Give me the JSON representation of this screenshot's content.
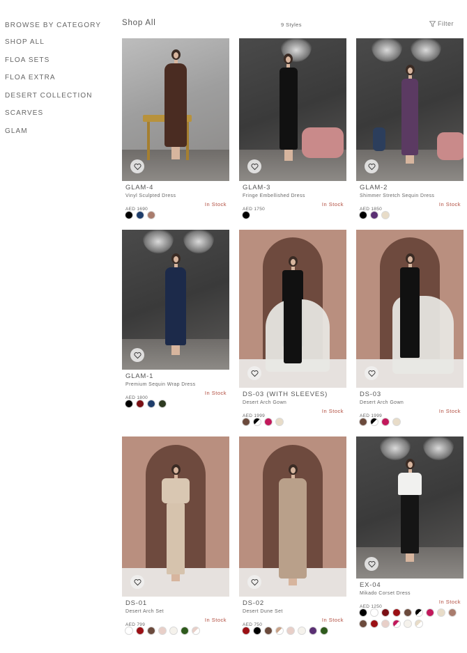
{
  "sidebar": {
    "heading": "BROWSE BY CATEGORY",
    "items": [
      "SHOP ALL",
      "FLOA SETS",
      "FLOA EXTRA",
      "DESERT COLLECTION",
      "SCARVES",
      "GLAM"
    ]
  },
  "header": {
    "title": "Shop All",
    "count": "9 Styles",
    "filter_label": "Filter",
    "filter_icon": "filter-icon"
  },
  "products": [
    {
      "code": "GLAM-4",
      "name": "Vinyl Sculpted Dress",
      "price": "AED 1690",
      "stock": "In Stock",
      "swatches": [
        "#000000",
        "#1e3d6b",
        "#a97c6d"
      ]
    },
    {
      "code": "GLAM-3",
      "name": "Fringe Embellished Dress",
      "price": "AED 1750",
      "stock": "In Stock",
      "swatches": [
        "#000000"
      ]
    },
    {
      "code": "GLAM-2",
      "name": "Shimmer Stretch Sequin Dress",
      "price": "AED 1850",
      "stock": "In Stock",
      "swatches": [
        "#000000",
        "#5a2f73",
        "#e8dcc8"
      ]
    },
    {
      "code": "GLAM-1",
      "name": "Premium Sequin Wrap Dress",
      "price": "AED 1800",
      "stock": "In Stock",
      "swatches": [
        "#000000",
        "#7a0f14",
        "#1e3d6b",
        "#2d3a20"
      ]
    },
    {
      "code": "DS-03 (WITH SLEEVES)",
      "name": "Desert Arch Gown",
      "price": "AED 1999",
      "stock": "In Stock",
      "swatches": [
        "#6b4a3c",
        "half:#000000:#ffffff",
        "#c2185b",
        "#e8dcc8"
      ]
    },
    {
      "code": "DS-03",
      "name": "Desert Arch Gown",
      "price": "AED 1999",
      "stock": "In Stock",
      "swatches": [
        "#6b4a3c",
        "half:#000000:#ffffff",
        "#c2185b",
        "#e8dcc8"
      ]
    },
    {
      "code": "DS-01",
      "name": "Desert Arch Set",
      "price": "AED 799",
      "stock": "In Stock",
      "swatches": [
        "#ffffff",
        "#9b0f14",
        "#6b4a3c",
        "#e8cfc8",
        "#f5f2ec",
        "#2e5a1c",
        "half:#e8cfc8:#ffffff"
      ]
    },
    {
      "code": "DS-02",
      "name": "Desert Dune Set",
      "price": "AED 750",
      "stock": "In Stock",
      "swatches": [
        "#9b0f14",
        "#000000",
        "#6b4a3c",
        "half:#c9a48a:#ffffff",
        "#e8cfc8",
        "#f5f2ec",
        "#5a2f73",
        "#2e5a1c"
      ]
    },
    {
      "code": "EX-04",
      "name": "Mikado Corset Dress",
      "price": "AED 1250",
      "stock": "In Stock",
      "swatches": [
        "#000000",
        "#ffffff",
        "#7a0f14",
        "#9b0f14",
        "#6b4a3c",
        "half:#000000:#ffffff",
        "#c2185b",
        "#e8dcc8",
        "#a97c6d",
        "#6b4a3c",
        "#9b0f14",
        "#e8cfc8",
        "half:#c2185b:#ffffff",
        "#f5f2ec",
        "half:#e8dcc8:#ffffff"
      ]
    }
  ],
  "icons": {
    "favorite": "heart-icon"
  }
}
